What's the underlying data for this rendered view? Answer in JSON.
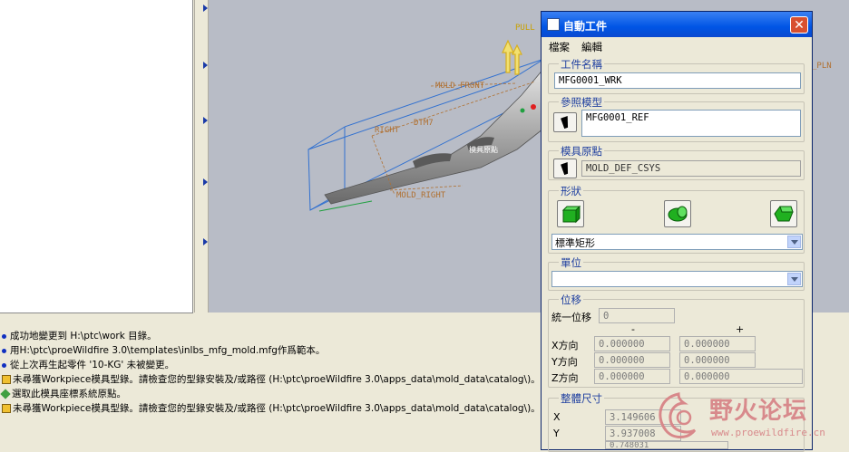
{
  "model_labels": {
    "pull": "PULL",
    "pln": "_PLN",
    "mold_front": "MOLD_FRONT",
    "right": "RIGHT",
    "dtm": "DTM7",
    "mold_right": "MOLD_RIGHT",
    "csys": "模具原點"
  },
  "messages": [
    {
      "type": "info",
      "text": "成功地變更到 H:\\ptc\\work 目錄。"
    },
    {
      "type": "info",
      "text": "用H:\\ptc\\proeWildfire 3.0\\templates\\inlbs_mfg_mold.mfg作爲範本。"
    },
    {
      "type": "info",
      "text": "從上次再生起零件 '10-KG' 未被變更。"
    },
    {
      "type": "warn",
      "text": "未尋獲Workpiece模具型錄。請檢查您的型錄安裝及/或路徑 (H:\\ptc\\proeWildfire 3.0\\apps_data\\mold_data\\catalog\\)。"
    },
    {
      "type": "prompt",
      "text": "選取此模具座標系統原點。"
    },
    {
      "type": "warn",
      "text": "未尋獲Workpiece模具型錄。請檢查您的型錄安裝及/或路徑 (H:\\ptc\\proeWildfire 3.0\\apps_data\\mold_data\\catalog\\)。"
    }
  ],
  "dialog": {
    "title": "自動工件",
    "close": "✕",
    "menu": [
      "檔案",
      "編輯"
    ],
    "workpiece_name_label": "工件名稱",
    "workpiece_name": "MFG0001_WRK",
    "ref_model_label": "參照模型",
    "ref_model": "MFG0001_REF",
    "origin_label": "模具原點",
    "origin": "MOLD_DEF_CSYS",
    "shape_label": "形狀",
    "shape_value": "標準矩形",
    "unit_label": "單位",
    "unit_value": "",
    "offset_label": "位移",
    "uniform_offset_label": "統一位移",
    "uniform_offset": "0",
    "minus": "-",
    "plus": "+",
    "x_dir": "X方向",
    "y_dir": "Y方向",
    "z_dir": "Z方向",
    "x_minus": "0.000000",
    "x_plus": "0.000000",
    "y_minus": "0.000000",
    "y_plus": "0.000000",
    "z_minus": "0.000000",
    "z_plus": "0.000000",
    "overall_label": "整體尺寸",
    "x_label": "X",
    "y_label": "Y",
    "x_size": "3.149606",
    "y_size": "3.937008",
    "z_size": "0.748031"
  },
  "watermark": {
    "title": "野火论坛",
    "url": "www.proewildfire.cn"
  },
  "colors": {
    "titlebar": "#0055e5",
    "group_label": "#2040a0",
    "model_edge": "#3070d0",
    "datum": "#b07030",
    "watermark": "#d8888a"
  }
}
